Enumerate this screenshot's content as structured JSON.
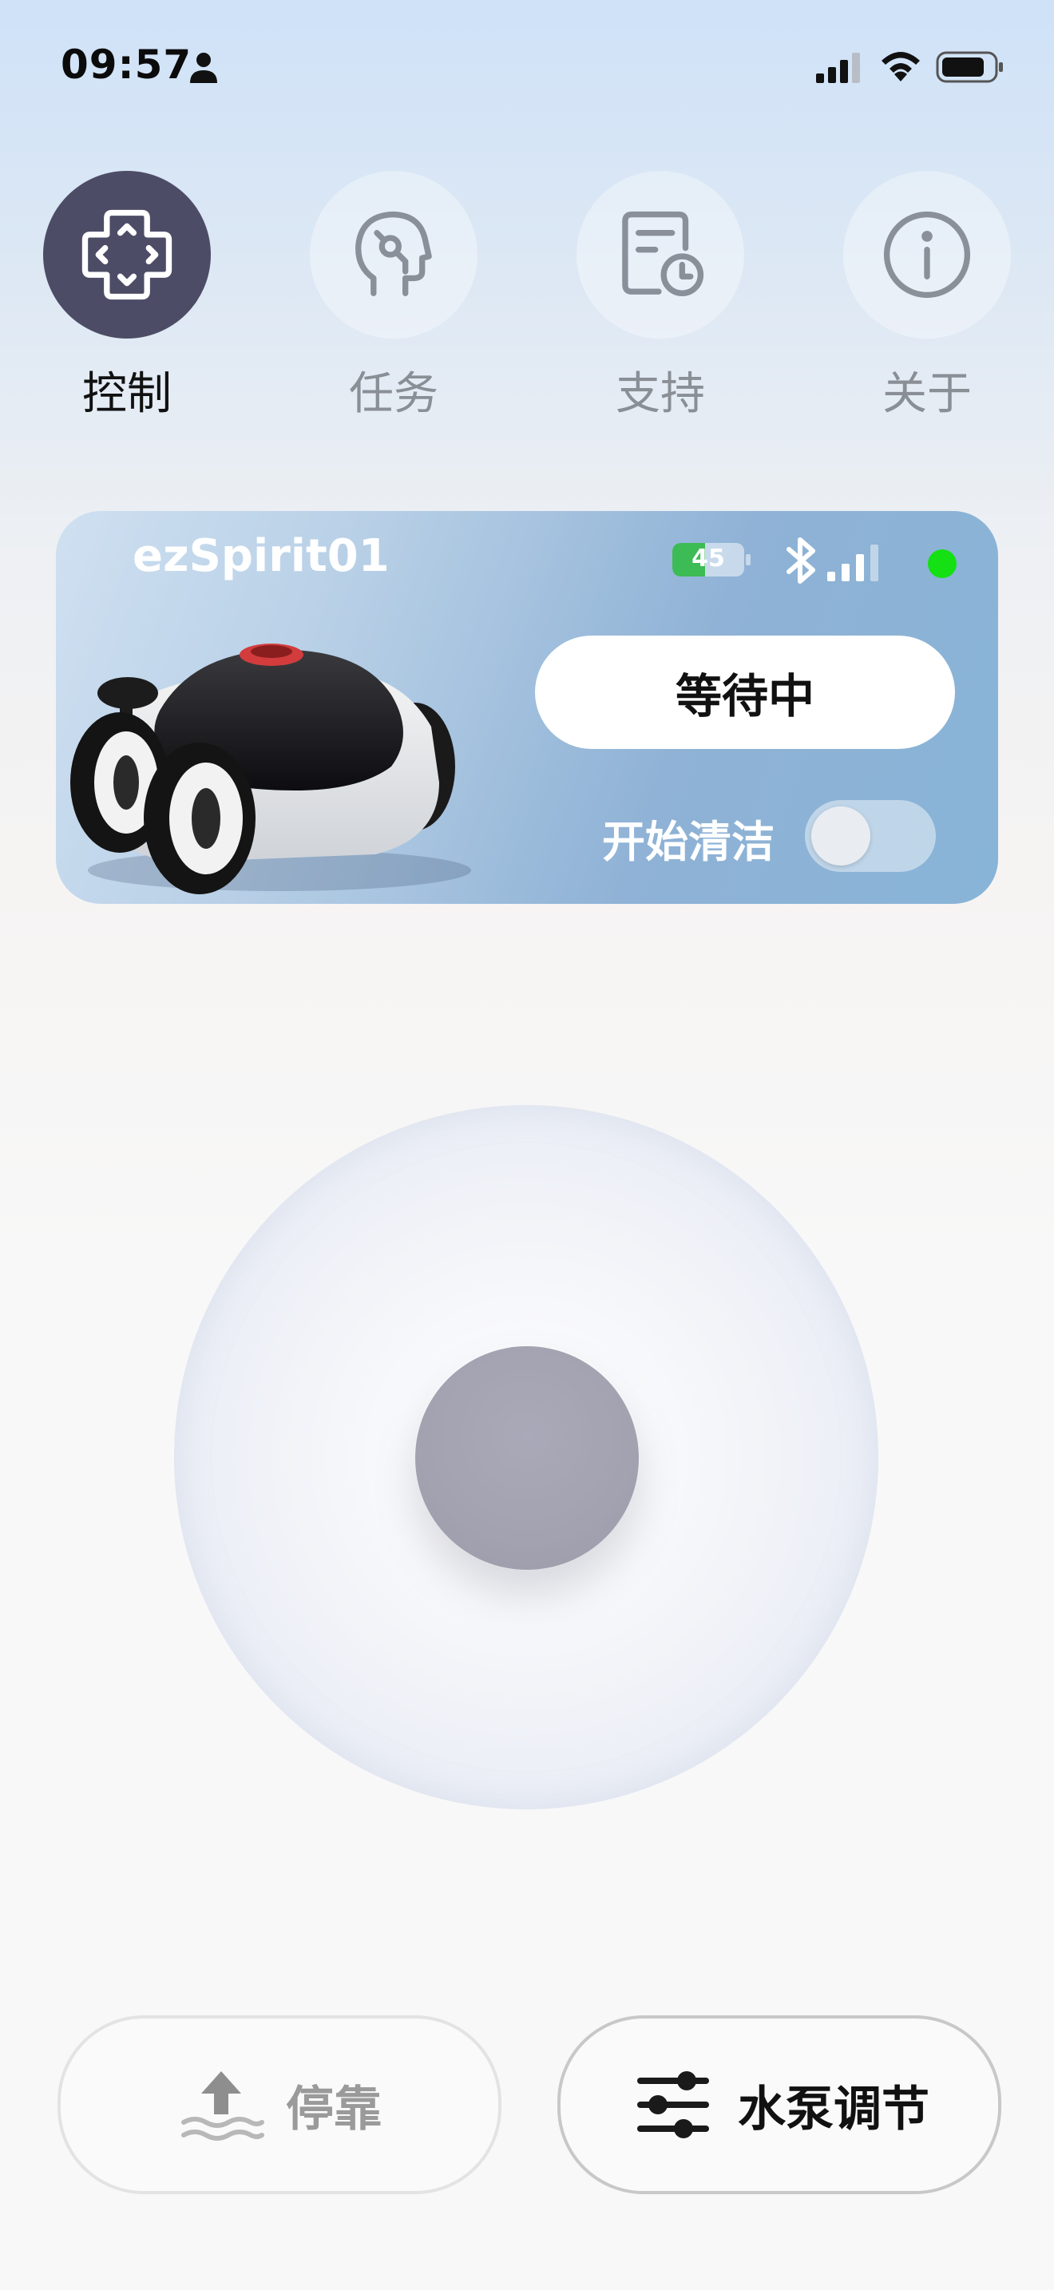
{
  "status_bar": {
    "time": "09:57"
  },
  "tabs": [
    {
      "label": "控制",
      "icon": "gamepad-icon",
      "active": true
    },
    {
      "label": "任务",
      "icon": "head-brain-icon",
      "active": false
    },
    {
      "label": "支持",
      "icon": "schedule-doc-icon",
      "active": false
    },
    {
      "label": "关于",
      "icon": "info-icon",
      "active": false
    }
  ],
  "device": {
    "name": "ezSpirit01",
    "battery_percent": 45,
    "battery_label": "45",
    "status": "等待中",
    "clean_label": "开始清洁",
    "cleaning_on": false,
    "online": true,
    "colors": {
      "online": "#14e014",
      "battery": "#3dbb55"
    }
  },
  "buttons": {
    "dock_label": "停靠",
    "pump_label": "水泵调节"
  },
  "colors": {
    "active_tab": "#4d4c66",
    "inactive_tab_label": "#8a8f96"
  }
}
